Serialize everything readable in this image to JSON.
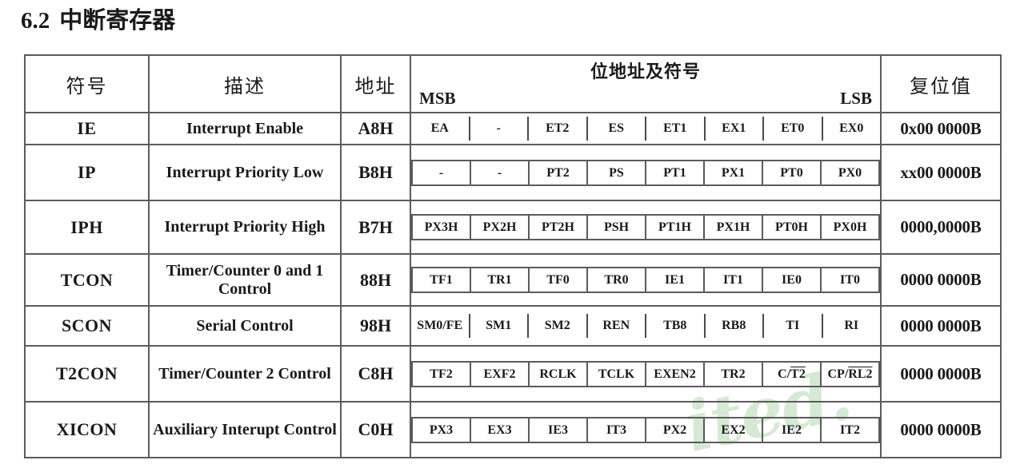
{
  "title": {
    "number": "6.2",
    "text": "中断寄存器"
  },
  "watermark": {
    "text": "ited."
  },
  "table": {
    "headers": {
      "symbol": "符号",
      "description": "描述",
      "address": "地址",
      "bits_title": "位地址及符号",
      "msb": "MSB",
      "lsb": "LSB",
      "reset": "复位值"
    },
    "rows": [
      {
        "symbol": "IE",
        "description": "Interrupt Enable",
        "address": "A8H",
        "style": "sep",
        "bits": [
          "EA",
          "-",
          "ET2",
          "ES",
          "ET1",
          "EX1",
          "ET0",
          "EX0"
        ],
        "reset": "0x00 0000B"
      },
      {
        "symbol": "IP",
        "description": "Interrupt Priority Low",
        "address": "B8H",
        "style": "boxed",
        "bits": [
          "-",
          "-",
          "PT2",
          "PS",
          "PT1",
          "PX1",
          "PT0",
          "PX0"
        ],
        "reset": "xx00 0000B"
      },
      {
        "symbol": "IPH",
        "description": "Interrupt Priority High",
        "address": "B7H",
        "style": "boxed",
        "bits": [
          "PX3H",
          "PX2H",
          "PT2H",
          "PSH",
          "PT1H",
          "PX1H",
          "PT0H",
          "PX0H"
        ],
        "reset": "0000,0000B"
      },
      {
        "symbol": "TCON",
        "description": "Timer/Counter 0 and 1 Control",
        "address": "88H",
        "style": "boxed",
        "bits": [
          "TF1",
          "TR1",
          "TF0",
          "TR0",
          "IE1",
          "IT1",
          "IE0",
          "IT0"
        ],
        "reset": "0000 0000B"
      },
      {
        "symbol": "SCON",
        "description": "Serial Control",
        "address": "98H",
        "style": "sep",
        "bits": [
          "SM0/FE",
          "SM1",
          "SM2",
          "REN",
          "TB8",
          "RB8",
          "TI",
          "RI"
        ],
        "reset": "0000 0000B"
      },
      {
        "symbol": "T2CON",
        "description": "Timer/Counter 2 Control",
        "address": "C8H",
        "style": "boxed",
        "bits": [
          "TF2",
          "EXF2",
          "RCLK",
          "TCLK",
          "EXEN2",
          "TR2",
          "C/T2",
          "CP/RL2"
        ],
        "bits_overline": [
          null,
          null,
          null,
          null,
          null,
          null,
          "T2",
          "RL2"
        ],
        "reset": "0000 0000B"
      },
      {
        "symbol": "XICON",
        "description": "Auxiliary Interupt Control",
        "address": "C0H",
        "style": "boxed",
        "bits": [
          "PX3",
          "EX3",
          "IE3",
          "IT3",
          "PX2",
          "EX2",
          "IE2",
          "IT2"
        ],
        "reset": "0000 0000B"
      }
    ]
  },
  "colors": {
    "border": "#5b5b5b",
    "text": "#1a1a1a",
    "watermark": "#cfe6cd",
    "background": "#ffffff"
  }
}
